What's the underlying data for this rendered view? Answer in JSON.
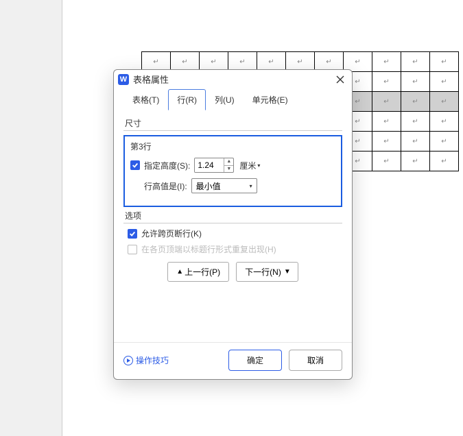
{
  "appIcon": "W",
  "dialogTitle": "表格属性",
  "tabs": {
    "table": "表格(T)",
    "row": "行(R)",
    "column": "列(U)",
    "cell": "单元格(E)"
  },
  "section": {
    "size": "尺寸",
    "options": "选项"
  },
  "rowGroup": {
    "title": "第3行",
    "specifyHeight": "指定高度(S):",
    "heightValue": "1.24",
    "unit": "厘米",
    "heightIsLabel": "行高值是(I):",
    "heightIsValue": "最小值"
  },
  "options": {
    "allowBreak": "允许跨页断行(K)",
    "repeatHeader": "在各页顶端以标题行形式重复出现(H)"
  },
  "nav": {
    "prev": "上一行(P)",
    "next": "下一行(N)"
  },
  "footer": {
    "tips": "操作技巧",
    "ok": "确定",
    "cancel": "取消"
  },
  "paraMark": "↵"
}
